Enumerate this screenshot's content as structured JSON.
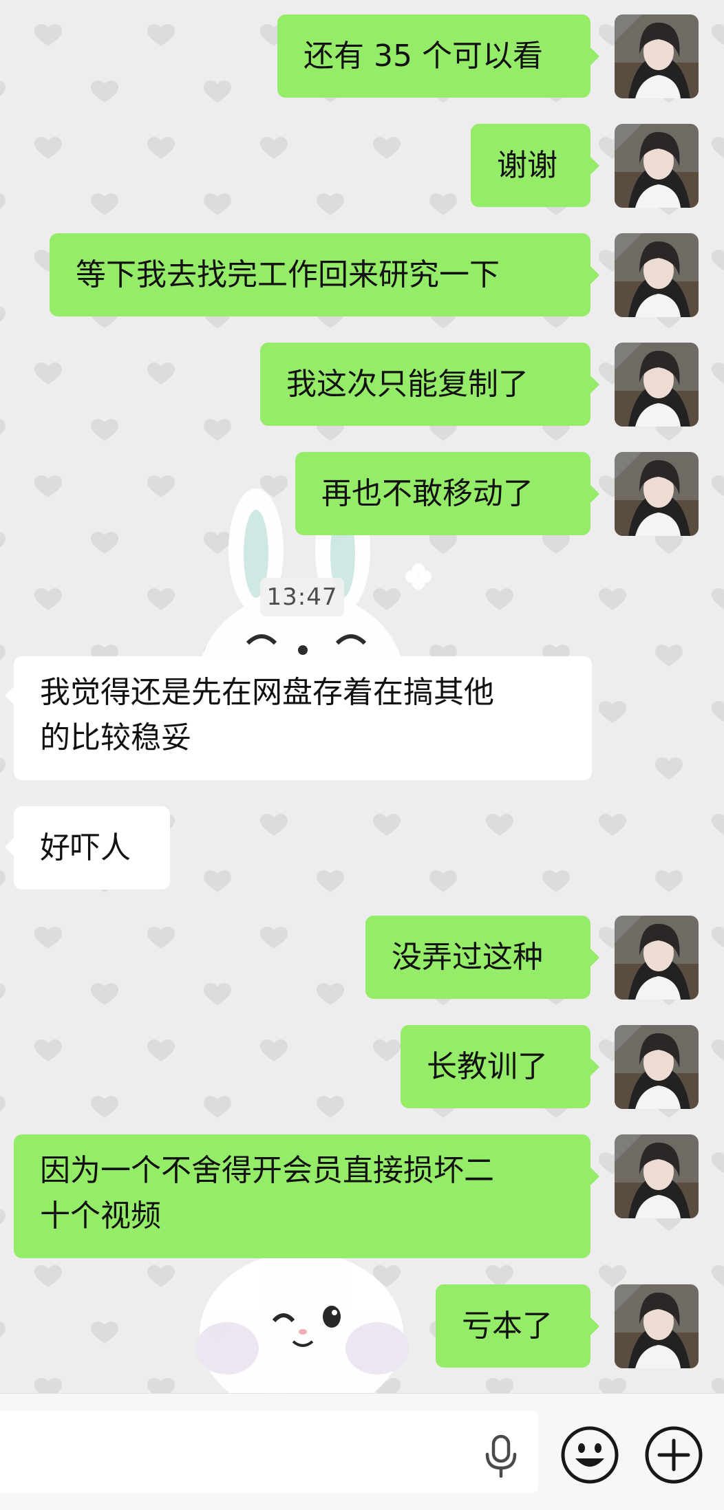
{
  "conversation": {
    "timestamp": "13:47",
    "messages": [
      {
        "from": "me",
        "text": "还有 35 个可以看"
      },
      {
        "from": "me",
        "text": "谢谢"
      },
      {
        "from": "me",
        "text": "等下我去找完工作回来研究一下"
      },
      {
        "from": "me",
        "text": "我这次只能复制了"
      },
      {
        "from": "me",
        "text": "再也不敢移动了"
      },
      {
        "from": "them",
        "lines": [
          "我觉得还是先在网盘存着在搞其他",
          "的比较稳妥"
        ]
      },
      {
        "from": "them",
        "text": "好吓人"
      },
      {
        "from": "me",
        "text": "没弄过这种"
      },
      {
        "from": "me",
        "text": "长教训了"
      },
      {
        "from": "me",
        "lines": [
          "因为一个不舍得开会员直接损坏二",
          "十个视频"
        ]
      },
      {
        "from": "me",
        "text": "亏本了"
      }
    ]
  },
  "input_bar": {
    "value": "",
    "voice_icon": "microphone-icon",
    "emoji_icon": "smiley-icon",
    "more_icon": "plus-circle-icon"
  },
  "colors": {
    "my_bubble": "#95ec69",
    "their_bubble": "#ffffff",
    "background": "#ededed"
  }
}
